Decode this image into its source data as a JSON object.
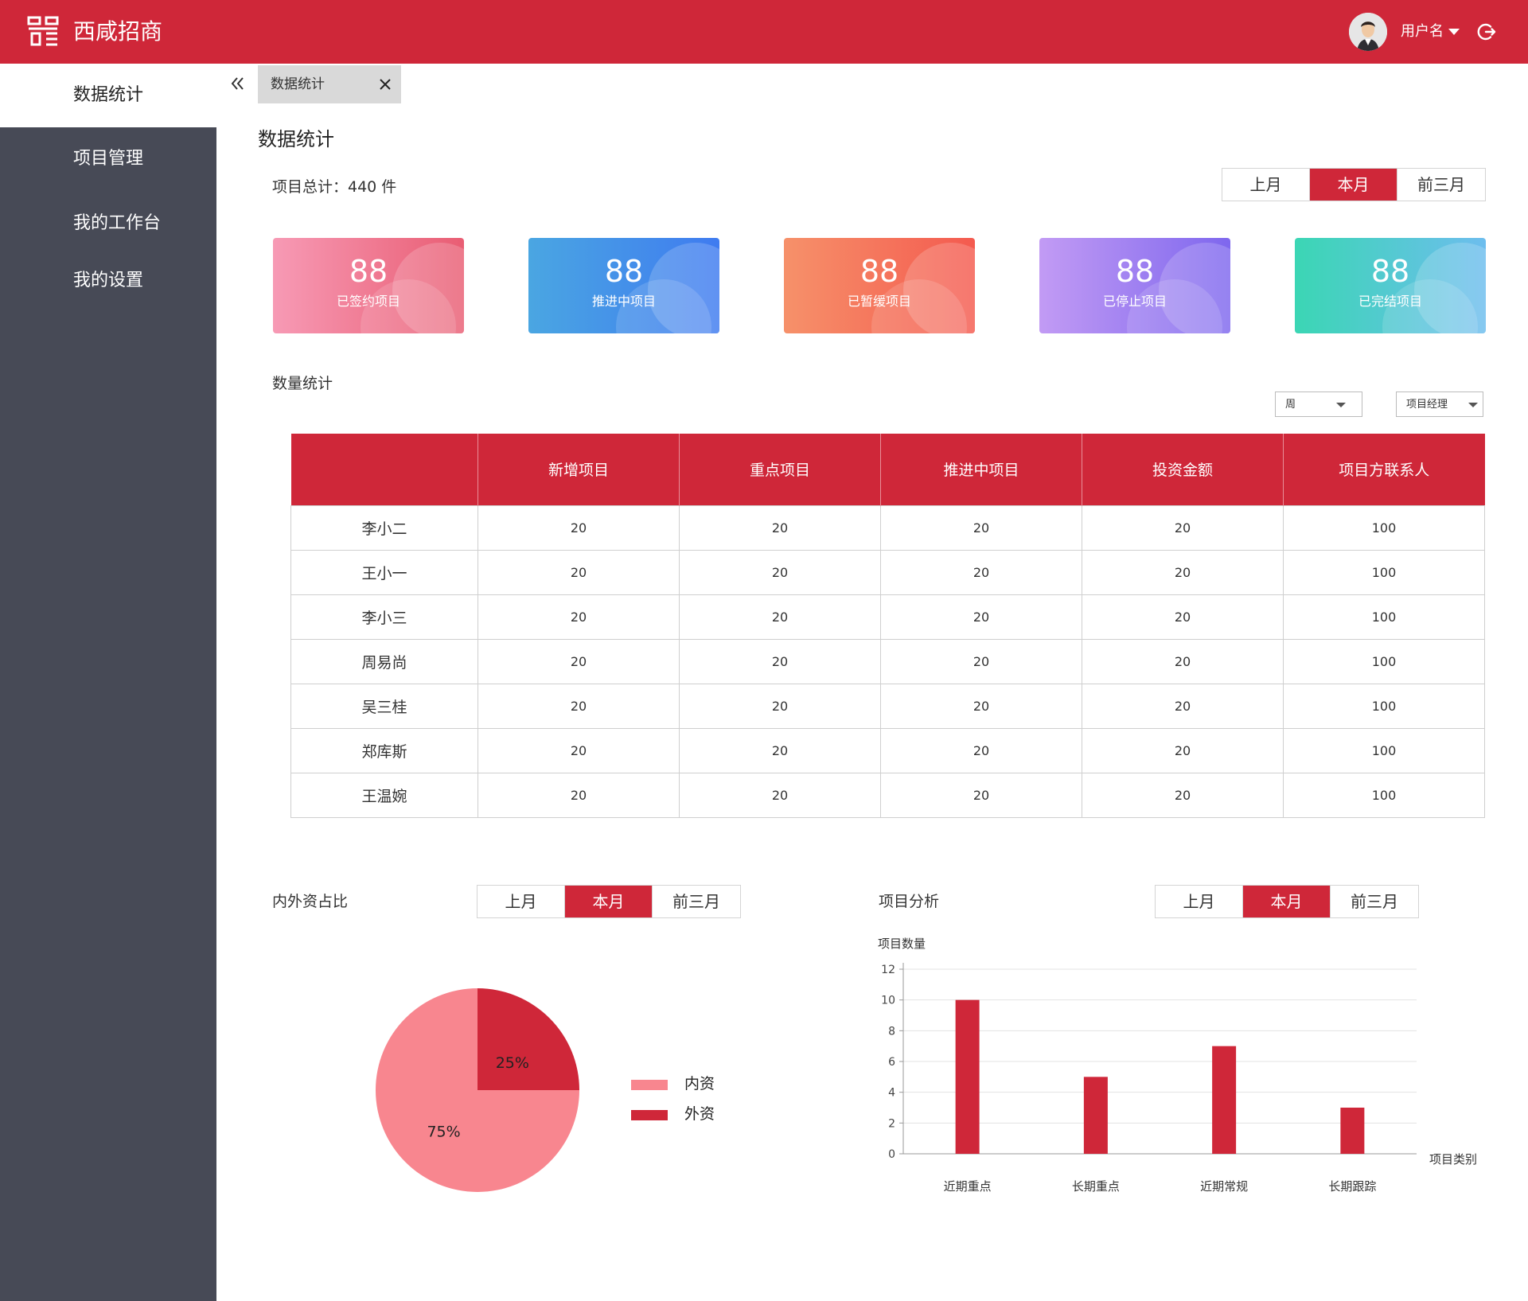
{
  "header": {
    "app_title": "西咸招商",
    "username": "用户名"
  },
  "sidebar": {
    "items": [
      {
        "label": "数据统计",
        "active": true
      },
      {
        "label": "项目管理",
        "active": false
      },
      {
        "label": "我的工作台",
        "active": false
      },
      {
        "label": "我的设置",
        "active": false
      }
    ]
  },
  "tabs": [
    {
      "label": "数据统计"
    }
  ],
  "page_title": "数据统计",
  "summary": {
    "total_label": "项目总计：440 件"
  },
  "period_options": [
    "上月",
    "本月",
    "前三月"
  ],
  "period_selected": "本月",
  "cards": [
    {
      "value": "88",
      "label": "已签约项目",
      "color_from": "#f79ab5",
      "color_to": "#e95d73"
    },
    {
      "value": "88",
      "label": "推进中项目",
      "color_from": "#4aa6e2",
      "color_to": "#3f7bf0"
    },
    {
      "value": "88",
      "label": "已暂缓项目",
      "color_from": "#f6916a",
      "color_to": "#f45a4f"
    },
    {
      "value": "88",
      "label": "已停止项目",
      "color_from": "#c29bf4",
      "color_to": "#7e67ee"
    },
    {
      "value": "88",
      "label": "已完结项目",
      "color_from": "#3bd6b4",
      "color_to": "#6dbdee"
    }
  ],
  "count_section": {
    "title": "数量统计",
    "filter_period": "周",
    "filter_role": "项目经理",
    "table": {
      "columns": [
        "",
        "新增项目",
        "重点项目",
        "推进中项目",
        "投资金额",
        "项目方联系人"
      ],
      "rows": [
        [
          "李小二",
          "20",
          "20",
          "20",
          "20",
          "100"
        ],
        [
          "王小一",
          "20",
          "20",
          "20",
          "20",
          "100"
        ],
        [
          "李小三",
          "20",
          "20",
          "20",
          "20",
          "100"
        ],
        [
          "周易尚",
          "20",
          "20",
          "20",
          "20",
          "100"
        ],
        [
          "吴三桂",
          "20",
          "20",
          "20",
          "20",
          "100"
        ],
        [
          "郑库斯",
          "20",
          "20",
          "20",
          "20",
          "100"
        ],
        [
          "王温婉",
          "20",
          "20",
          "20",
          "20",
          "100"
        ]
      ]
    }
  },
  "pie_section": {
    "title": "内外资占比"
  },
  "bar_section": {
    "title": "项目分析"
  },
  "colors": {
    "brand": "#cf2739",
    "sidebar": "#474a56",
    "pie_light": "#f8868f",
    "pie_dark": "#cf2739"
  },
  "chart_data": [
    {
      "type": "pie",
      "labels": [
        "内资",
        "外资"
      ],
      "values": [
        75,
        25
      ],
      "value_labels": [
        "75%",
        "25%"
      ],
      "colors": [
        "#f8868f",
        "#cf2739"
      ],
      "legend": "right"
    },
    {
      "type": "bar",
      "categories": [
        "近期重点",
        "长期重点",
        "近期常规",
        "长期跟踪"
      ],
      "values": [
        10,
        5,
        7,
        3
      ],
      "ylabel": "项目数量",
      "xlabel": "项目类别",
      "ylim": [
        0,
        12
      ],
      "yticks": [
        0,
        2,
        4,
        6,
        8,
        10,
        12
      ],
      "grid": true,
      "color": "#cf2739"
    }
  ]
}
